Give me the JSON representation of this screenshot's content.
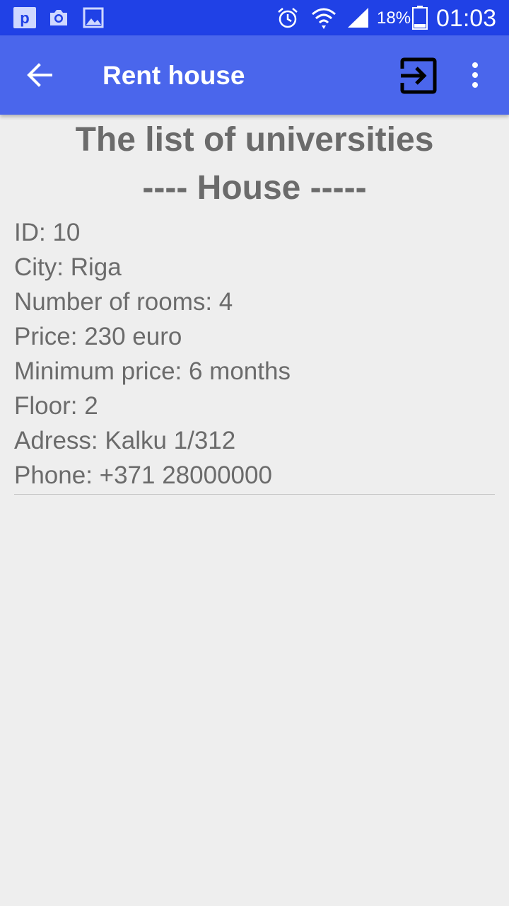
{
  "status_bar": {
    "battery_percent": "18%",
    "time": "01:03",
    "icons": [
      "pinterest-icon",
      "camera-icon",
      "gallery-icon",
      "alarm-icon",
      "wifi-icon",
      "signal-icon",
      "battery-icon"
    ]
  },
  "app_bar": {
    "title": "Rent house",
    "icons": [
      "back-arrow-icon",
      "exit-icon",
      "more-vert-icon"
    ]
  },
  "content": {
    "heading": "The list of universities",
    "subheading": "---- House -----",
    "details": [
      "ID: 10",
      "City: Riga",
      "Number of rooms: 4",
      "Price: 230 euro",
      "Minimum price: 6 months",
      "Floor: 2",
      "Adress: Kalku 1/312",
      "Phone: +371 28000000"
    ]
  },
  "colors": {
    "status_bar": "#2041e6",
    "app_bar": "#4a66ec",
    "background": "#eeeeee",
    "text": "#6b6b6b"
  }
}
